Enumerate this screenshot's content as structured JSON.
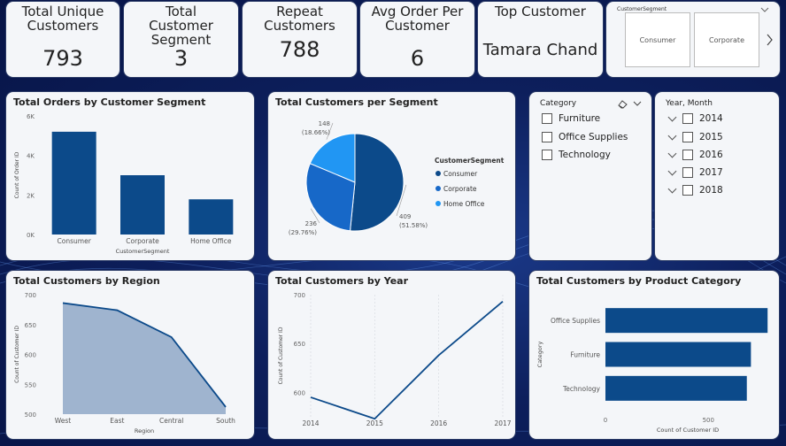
{
  "kpis": {
    "unique_customers": {
      "title": "Total Unique Customers",
      "value": "793"
    },
    "customer_segment": {
      "title": "Total Customer Segment",
      "value": "3"
    },
    "repeat_customers": {
      "title": "Repeat Customers",
      "value": "788"
    },
    "avg_order": {
      "title": "Avg Order Per Customer",
      "value": "6"
    },
    "top_customer": {
      "title": "Top Customer",
      "value": "Tamara Chand"
    }
  },
  "segment_slicer": {
    "title": "CustomerSegment",
    "tiles": [
      "Consumer",
      "Corporate"
    ],
    "chevron_icon": "chevron-down-icon",
    "next_icon": "chevron-right-icon"
  },
  "category_slicer": {
    "title": "Category",
    "items": [
      "Furniture",
      "Office Supplies",
      "Technology"
    ],
    "eraser_icon": "eraser-icon"
  },
  "year_slicer": {
    "title": "Year, Month",
    "items": [
      "2014",
      "2015",
      "2016",
      "2017",
      "2018"
    ]
  },
  "colors": {
    "primary": "#0c4a8a",
    "mid": "#1768c8",
    "light": "#2196f3",
    "area_fill": "#8fa8c8"
  },
  "chart_data": [
    {
      "id": "orders_by_segment",
      "type": "bar",
      "title": "Total Orders by Customer Segment",
      "xlabel": "CustomerSegment",
      "ylabel": "Count of Order ID",
      "categories": [
        "Consumer",
        "Corporate",
        "Home Office"
      ],
      "values": [
        5200,
        3000,
        1780
      ],
      "ylim": [
        0,
        6000
      ],
      "yticks": [
        {
          "v": 0,
          "l": "0K"
        },
        {
          "v": 2000,
          "l": "2K"
        },
        {
          "v": 4000,
          "l": "4K"
        },
        {
          "v": 6000,
          "l": "6K"
        }
      ]
    },
    {
      "id": "customers_per_segment",
      "type": "pie",
      "title": "Total Customers per Segment",
      "legend_title": "CustomerSegment",
      "legend_position": "right",
      "slices": [
        {
          "label": "Consumer",
          "value": 409,
          "pct": "(51.58%)"
        },
        {
          "label": "Corporate",
          "value": 236,
          "pct": "(29.76%)"
        },
        {
          "label": "Home Office",
          "value": 148,
          "pct": "(18.66%)"
        }
      ]
    },
    {
      "id": "customers_by_region",
      "type": "area",
      "title": "Total Customers by Region",
      "xlabel": "Region",
      "ylabel": "Count of Customer ID",
      "categories": [
        "West",
        "East",
        "Central",
        "South"
      ],
      "values": [
        686,
        674,
        629,
        512
      ],
      "ylim": [
        500,
        700
      ],
      "yticks": [
        500,
        550,
        600,
        650,
        700
      ]
    },
    {
      "id": "customers_by_year",
      "type": "line",
      "title": "Total Customers by Year",
      "ylabel": "Count of Customer ID",
      "x": [
        "2014",
        "2015",
        "2016",
        "2017"
      ],
      "values": [
        595,
        573,
        638,
        693
      ],
      "ylim": [
        575,
        700
      ],
      "yticks": [
        600,
        650,
        700
      ]
    },
    {
      "id": "customers_by_category",
      "type": "bar",
      "orientation": "horizontal",
      "title": "Total Customers by Product Category",
      "xlabel": "Count of Customer ID",
      "ylabel": "Category",
      "categories": [
        "Office Supplies",
        "Furniture",
        "Technology"
      ],
      "values": [
        788,
        707,
        687
      ],
      "xlim": [
        0,
        800
      ],
      "xticks": [
        0,
        500
      ]
    }
  ]
}
